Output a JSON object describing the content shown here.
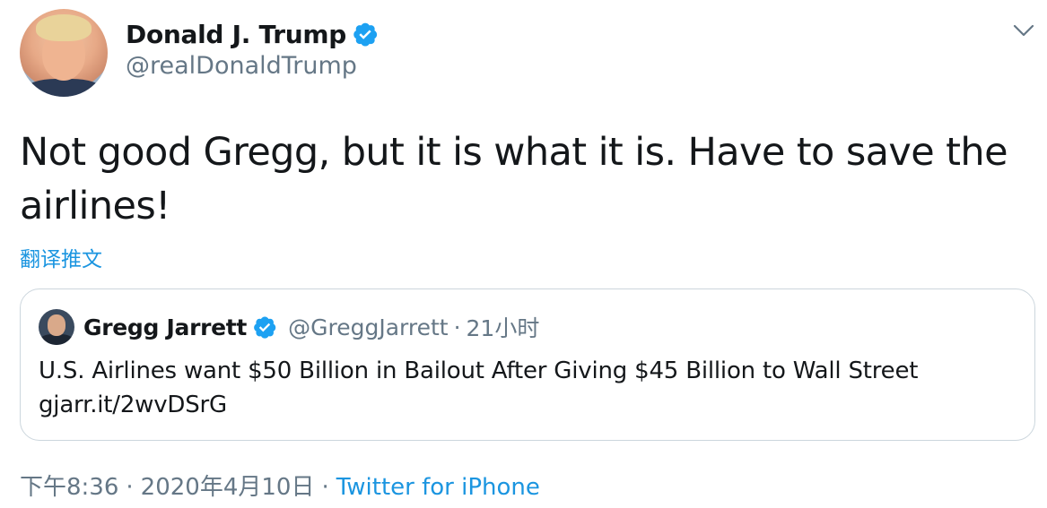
{
  "author": {
    "display_name": "Donald J. Trump",
    "handle": "@realDonaldTrump",
    "verified": true,
    "verified_badge_icon": "verified-badge-icon"
  },
  "tweet": {
    "text": "Not good Gregg, but it is what it is. Have to save the airlines!",
    "translate_label": "翻译推文"
  },
  "quoted_tweet": {
    "display_name": "Gregg Jarrett",
    "handle": "@GreggJarrett",
    "separator": "·",
    "time": "21小时",
    "text": "U.S. Airlines want $50 Billion in Bailout After Giving $45 Billion to Wall Street gjarr.it/2wvDSrG",
    "verified": true
  },
  "meta": {
    "time": "下午8:36",
    "sep1": "·",
    "date": "2020年4月10日",
    "sep2": "·",
    "source": "Twitter for iPhone"
  },
  "icons": {
    "menu": "chevron-down-icon",
    "verified": "verified-badge-icon"
  },
  "colors": {
    "link": "#1b95e0",
    "verified": "#1da1f2",
    "secondary_text": "#657786",
    "primary_text": "#14171a",
    "border": "#ccd6dd"
  }
}
